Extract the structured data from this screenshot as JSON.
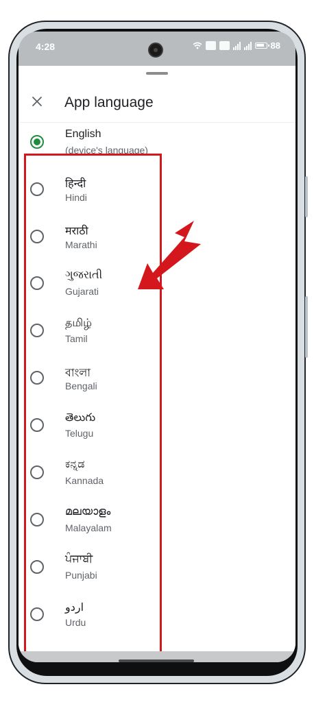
{
  "status_bar": {
    "time": "4:28",
    "battery": "88"
  },
  "sheet": {
    "title": "App language"
  },
  "languages": [
    {
      "native": "English",
      "sub": "(device's language)",
      "selected": true
    },
    {
      "native": "हिन्दी",
      "sub": "Hindi",
      "selected": false
    },
    {
      "native": "मराठी",
      "sub": "Marathi",
      "selected": false
    },
    {
      "native": "ગુજરાતી",
      "sub": "Gujarati",
      "selected": false
    },
    {
      "native": "தமிழ்",
      "sub": "Tamil",
      "selected": false
    },
    {
      "native": "বাংলা",
      "sub": "Bengali",
      "selected": false
    },
    {
      "native": "తెలుగు",
      "sub": "Telugu",
      "selected": false
    },
    {
      "native": "ಕನ್ನಡ",
      "sub": "Kannada",
      "selected": false
    },
    {
      "native": "മലയാളം",
      "sub": "Malayalam",
      "selected": false
    },
    {
      "native": "ਪੰਜਾਬੀ",
      "sub": "Punjabi",
      "selected": false
    },
    {
      "native": "اردو",
      "sub": "Urdu",
      "selected": false
    }
  ],
  "colors": {
    "selected_radio": "#1e8e3e",
    "highlight": "#d4171d",
    "arrow": "#d4171d"
  }
}
